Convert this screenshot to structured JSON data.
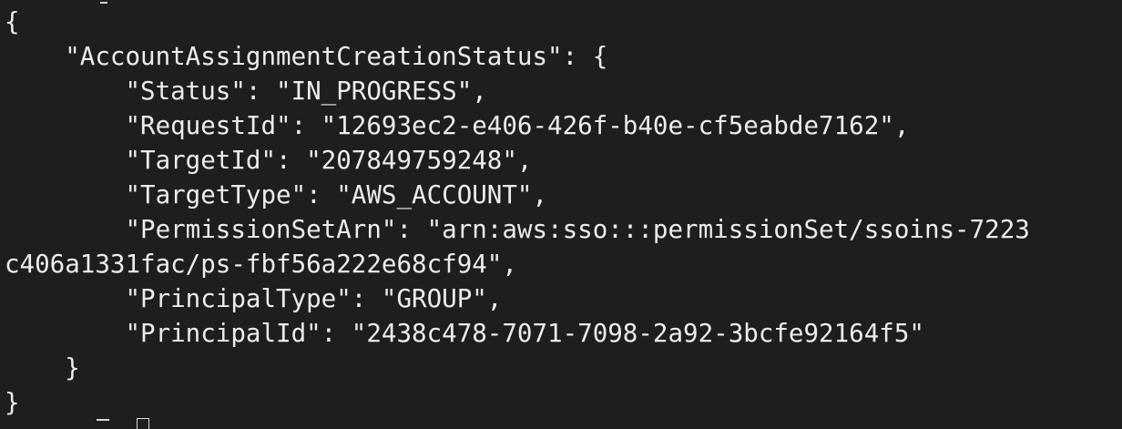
{
  "terminal": {
    "lines": [
      "{",
      "    \"AccountAssignmentCreationStatus\": {",
      "        \"Status\": \"IN_PROGRESS\",",
      "        \"RequestId\": \"12693ec2-e406-426f-b40e-cf5eabde7162\",",
      "        \"TargetId\": \"207849759248\",",
      "        \"TargetType\": \"AWS_ACCOUNT\",",
      "        \"PermissionSetArn\": \"arn:aws:sso:::permissionSet/ssoins-7223",
      "c406a1331fac/ps-fbf56a222e68cf94\",",
      "        \"PrincipalType\": \"GROUP\",",
      "        \"PrincipalId\": \"2438c478-7071-7098-2a92-3bcfe92164f5\"",
      "    }",
      "}"
    ]
  },
  "colors": {
    "background": "#1e1e1e",
    "text": "#ececec"
  }
}
